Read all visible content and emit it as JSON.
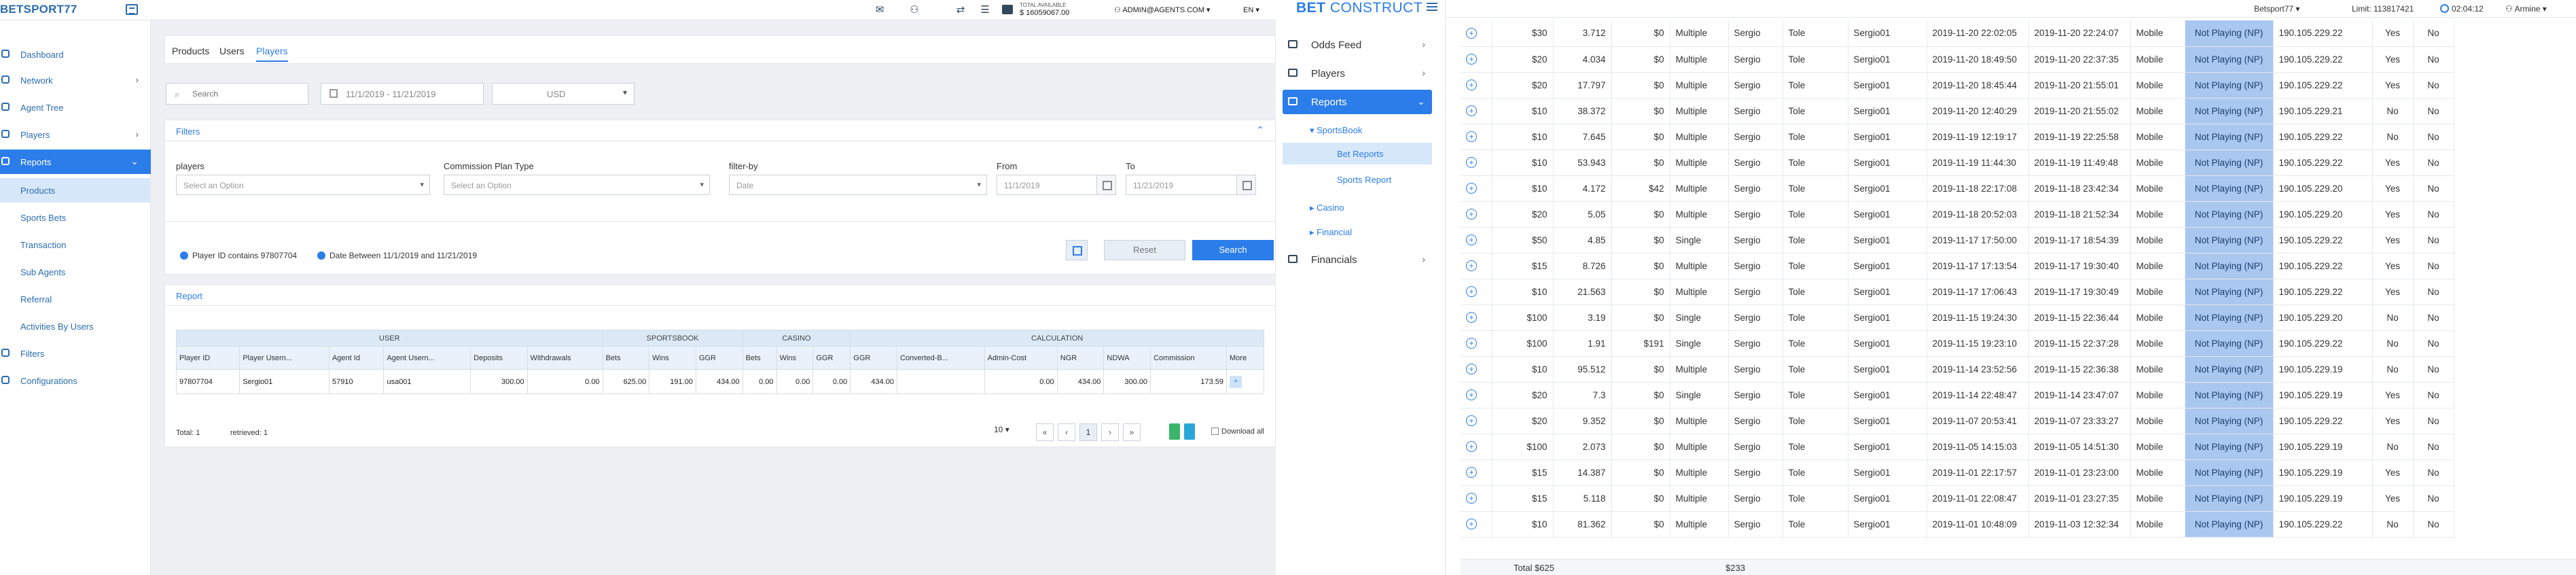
{
  "left": {
    "brand": "BETSPORT77",
    "balance": {
      "label": "TOTAL AVAILABLE",
      "value": "$ 16059067.00"
    },
    "admin": "ADMIN@AGENTS.COM",
    "lang": "EN",
    "nav": [
      {
        "label": "Dashboard"
      },
      {
        "label": "Network"
      },
      {
        "label": "Agent Tree"
      },
      {
        "label": "Players"
      },
      {
        "label": "Reports"
      }
    ],
    "subnav": [
      "Products",
      "Sports Bets",
      "Transaction",
      "Sub Agents",
      "Referral",
      "Activities By Users",
      "Filters",
      "Configurations"
    ],
    "tabs": [
      "Products",
      "Users",
      "Players"
    ],
    "search_placeholder": "Search",
    "date_range": "11/1/2019 - 11/21/2019",
    "currency": "USD",
    "filters": {
      "title": "Filters",
      "players_label": "players",
      "players_value": "Select an Option",
      "plan_label": "Commission Plan Type",
      "plan_value": "Select an Option",
      "filterby_label": "filter-by",
      "filterby_value": "Date",
      "from_label": "From",
      "from_value": "11/1/2019",
      "to_label": "To",
      "to_value": "11/21/2019",
      "chip1": "Player ID contains 97807704",
      "chip2": "Date Between 11/1/2019 and 11/21/2019",
      "reset": "Reset",
      "search": "Search"
    },
    "report": {
      "title": "Report",
      "groups": [
        "USER",
        "SPORTSBOOK",
        "CASINO",
        "CALCULATION"
      ],
      "headers": [
        "Player ID",
        "Player Usern...",
        "Agent Id",
        "Agent Usern...",
        "Deposits",
        "Withdrawals",
        "Bets",
        "Wins",
        "GGR",
        "Bets",
        "Wins",
        "GGR",
        "GGR",
        "Converted-B...",
        "Admin-Cost",
        "NGR",
        "NDWA",
        "Commission",
        "More"
      ],
      "row": [
        "97807704",
        "Sergio01",
        "57910",
        "usa001",
        "300.00",
        "0.00",
        "625.00",
        "191.00",
        "434.00",
        "0.00",
        "0.00",
        "0.00",
        "434.00",
        "",
        "0.00",
        "434.00",
        "300.00",
        "173.59",
        "+"
      ],
      "total": "Total: 1",
      "retrieved": "retrieved: 1",
      "page_size": "10",
      "current_page": "1",
      "download_all": "Download all"
    }
  },
  "right": {
    "logo_a": "BET",
    "logo_b": "CONSTRUCT",
    "nav": [
      {
        "label": "Odds Feed"
      },
      {
        "label": "Players"
      },
      {
        "label": "Reports"
      }
    ],
    "reports_sub": [
      "SportsBook",
      "Bet Reports",
      "Sports Report",
      "Casino",
      "Financial"
    ],
    "financials": "Financials",
    "topbar": {
      "site": "Betsport77",
      "limit": "Limit: 113817421",
      "time": "02:04:12",
      "user": "Armine"
    },
    "rows": [
      [
        "$30",
        "3.712",
        "$0",
        "Multiple",
        "Sergio",
        "Tole",
        "Sergio01",
        "2019-11-20 22:02:05",
        "2019-11-20 22:24:07",
        "Mobile",
        "Not Playing (NP)",
        "190.105.229.22",
        "Yes",
        "No"
      ],
      [
        "$20",
        "4.034",
        "$0",
        "Multiple",
        "Sergio",
        "Tole",
        "Sergio01",
        "2019-11-20 18:49:50",
        "2019-11-20 22:37:35",
        "Mobile",
        "Not Playing (NP)",
        "190.105.229.22",
        "Yes",
        "No"
      ],
      [
        "$20",
        "17.797",
        "$0",
        "Multiple",
        "Sergio",
        "Tole",
        "Sergio01",
        "2019-11-20 18:45:44",
        "2019-11-20 21:55:01",
        "Mobile",
        "Not Playing (NP)",
        "190.105.229.22",
        "Yes",
        "No"
      ],
      [
        "$10",
        "38.372",
        "$0",
        "Multiple",
        "Sergio",
        "Tole",
        "Sergio01",
        "2019-11-20 12:40:29",
        "2019-11-20 21:55:02",
        "Mobile",
        "Not Playing (NP)",
        "190.105.229.21",
        "No",
        "No"
      ],
      [
        "$10",
        "7.645",
        "$0",
        "Multiple",
        "Sergio",
        "Tole",
        "Sergio01",
        "2019-11-19 12:19:17",
        "2019-11-19 22:25:58",
        "Mobile",
        "Not Playing (NP)",
        "190.105.229.22",
        "No",
        "No"
      ],
      [
        "$10",
        "53.943",
        "$0",
        "Multiple",
        "Sergio",
        "Tole",
        "Sergio01",
        "2019-11-19 11:44:30",
        "2019-11-19 11:49:48",
        "Mobile",
        "Not Playing (NP)",
        "190.105.229.22",
        "Yes",
        "No"
      ],
      [
        "$10",
        "4.172",
        "$42",
        "Multiple",
        "Sergio",
        "Tole",
        "Sergio01",
        "2019-11-18 22:17:08",
        "2019-11-18 23:42:34",
        "Mobile",
        "Not Playing (NP)",
        "190.105.229.20",
        "Yes",
        "No"
      ],
      [
        "$20",
        "5.05",
        "$0",
        "Multiple",
        "Sergio",
        "Tole",
        "Sergio01",
        "2019-11-18 20:52:03",
        "2019-11-18 21:52:34",
        "Mobile",
        "Not Playing (NP)",
        "190.105.229.20",
        "Yes",
        "No"
      ],
      [
        "$50",
        "4.85",
        "$0",
        "Single",
        "Sergio",
        "Tole",
        "Sergio01",
        "2019-11-17 17:50:00",
        "2019-11-17 18:54:39",
        "Mobile",
        "Not Playing (NP)",
        "190.105.229.22",
        "Yes",
        "No"
      ],
      [
        "$15",
        "8.726",
        "$0",
        "Multiple",
        "Sergio",
        "Tole",
        "Sergio01",
        "2019-11-17 17:13:54",
        "2019-11-17 19:30:40",
        "Mobile",
        "Not Playing (NP)",
        "190.105.229.22",
        "Yes",
        "No"
      ],
      [
        "$10",
        "21.563",
        "$0",
        "Multiple",
        "Sergio",
        "Tole",
        "Sergio01",
        "2019-11-17 17:06:43",
        "2019-11-17 19:30:49",
        "Mobile",
        "Not Playing (NP)",
        "190.105.229.22",
        "Yes",
        "No"
      ],
      [
        "$100",
        "3.19",
        "$0",
        "Single",
        "Sergio",
        "Tole",
        "Sergio01",
        "2019-11-15 19:24:30",
        "2019-11-15 22:36:44",
        "Mobile",
        "Not Playing (NP)",
        "190.105.229.20",
        "No",
        "No"
      ],
      [
        "$100",
        "1.91",
        "$191",
        "Single",
        "Sergio",
        "Tole",
        "Sergio01",
        "2019-11-15 19:23:10",
        "2019-11-15 22:37:28",
        "Mobile",
        "Not Playing (NP)",
        "190.105.229.22",
        "No",
        "No"
      ],
      [
        "$10",
        "95.512",
        "$0",
        "Multiple",
        "Sergio",
        "Tole",
        "Sergio01",
        "2019-11-14 23:52:56",
        "2019-11-15 22:36:38",
        "Mobile",
        "Not Playing (NP)",
        "190.105.229.19",
        "No",
        "No"
      ],
      [
        "$20",
        "7.3",
        "$0",
        "Single",
        "Sergio",
        "Tole",
        "Sergio01",
        "2019-11-14 22:48:47",
        "2019-11-14 23:47:07",
        "Mobile",
        "Not Playing (NP)",
        "190.105.229.19",
        "Yes",
        "No"
      ],
      [
        "$20",
        "9.352",
        "$0",
        "Multiple",
        "Sergio",
        "Tole",
        "Sergio01",
        "2019-11-07 20:53:41",
        "2019-11-07 23:33:27",
        "Mobile",
        "Not Playing (NP)",
        "190.105.229.22",
        "Yes",
        "No"
      ],
      [
        "$100",
        "2.073",
        "$0",
        "Multiple",
        "Sergio",
        "Tole",
        "Sergio01",
        "2019-11-05 14:15:03",
        "2019-11-05 14:51:30",
        "Mobile",
        "Not Playing (NP)",
        "190.105.229.19",
        "No",
        "No"
      ],
      [
        "$15",
        "14.387",
        "$0",
        "Multiple",
        "Sergio",
        "Tole",
        "Sergio01",
        "2019-11-01 22:17:57",
        "2019-11-01 23:23:00",
        "Mobile",
        "Not Playing (NP)",
        "190.105.229.19",
        "Yes",
        "No"
      ],
      [
        "$15",
        "5.118",
        "$0",
        "Multiple",
        "Sergio",
        "Tole",
        "Sergio01",
        "2019-11-01 22:08:47",
        "2019-11-01 23:27:35",
        "Mobile",
        "Not Playing (NP)",
        "190.105.229.19",
        "Yes",
        "No"
      ],
      [
        "$10",
        "81.362",
        "$0",
        "Multiple",
        "Sergio",
        "Tole",
        "Sergio01",
        "2019-11-01 10:48:09",
        "2019-11-03 12:32:34",
        "Mobile",
        "Not Playing (NP)",
        "190.105.229.22",
        "No",
        "No"
      ]
    ],
    "total_label": "Total $625",
    "total_wins": "$233"
  }
}
